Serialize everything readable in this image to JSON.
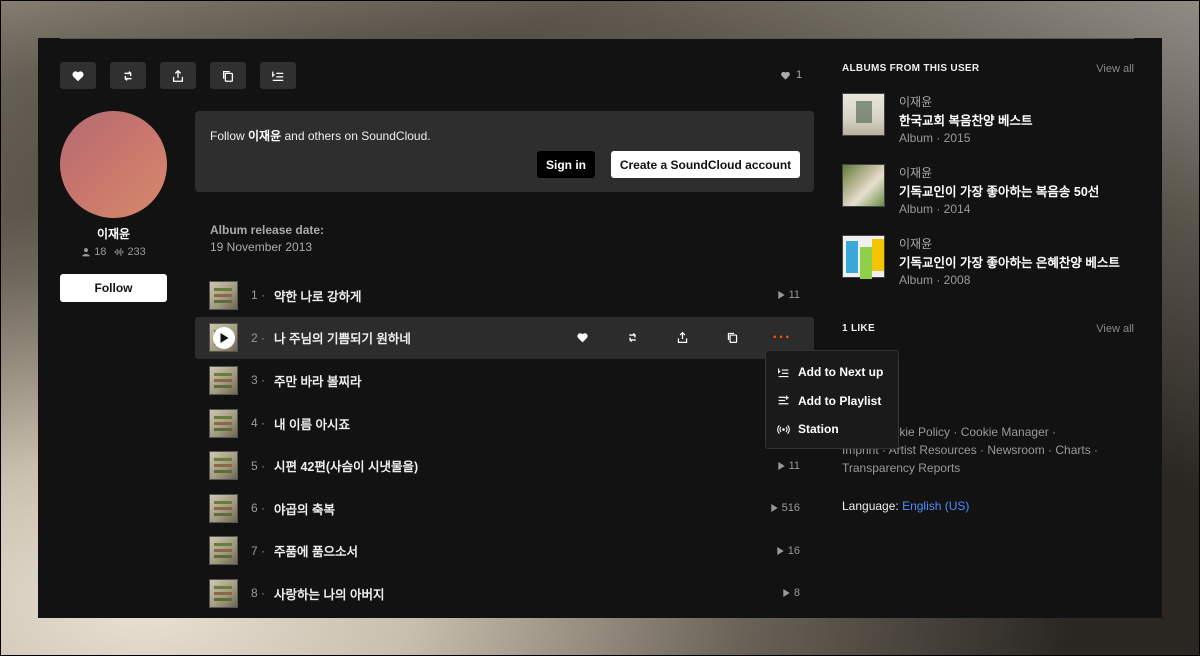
{
  "actions": {
    "like": "like",
    "repost": "repost",
    "share": "share",
    "copy": "copy link",
    "add_to_next_up": "add to next up"
  },
  "likes_count": "1",
  "user": {
    "name": "이재윤",
    "followers": "18",
    "tracks": "233",
    "follow_label": "Follow"
  },
  "follow_box": {
    "text_prefix": "Follow ",
    "text_name": "이재윤",
    "text_suffix": " and others on SoundCloud.",
    "signin_label": "Sign in",
    "create_label": "Create a SoundCloud account"
  },
  "release": {
    "label": "Album release date:",
    "date": "19 November 2013"
  },
  "tracks": [
    {
      "num": "1 ·",
      "title": "약한 나로 강하게",
      "plays": "11"
    },
    {
      "num": "2 ·",
      "title": "나 주님의 기쁨되기 원하네",
      "plays": ""
    },
    {
      "num": "3 ·",
      "title": "주만 바라 볼찌라",
      "plays": ""
    },
    {
      "num": "4 ·",
      "title": "내 이름 아시죠",
      "plays": ""
    },
    {
      "num": "5 ·",
      "title": "시편 42편(사슴이 시냇물을)",
      "plays": "11"
    },
    {
      "num": "6 ·",
      "title": "야곱의 축복",
      "plays": "516"
    },
    {
      "num": "7 ·",
      "title": "주품에 품으소서",
      "plays": "16"
    },
    {
      "num": "8 ·",
      "title": "사랑하는 나의 아버지",
      "plays": "8"
    }
  ],
  "more_dots": "···",
  "menu": {
    "items": [
      {
        "label": "Add to Next up",
        "icon": "next-up-icon"
      },
      {
        "label": "Add to Playlist",
        "icon": "playlist-icon"
      },
      {
        "label": "Station",
        "icon": "station-icon"
      }
    ]
  },
  "albums_section": {
    "title": "ALBUMS FROM THIS USER",
    "view_all": "View all",
    "albums": [
      {
        "artist": "이재윤",
        "title": "한국교회 복음찬양 베스트",
        "meta": "Album · 2015"
      },
      {
        "artist": "이재윤",
        "title": "기독교인이 가장 좋아하는 복음송 50선",
        "meta": "Album · 2014"
      },
      {
        "artist": "이재윤",
        "title": "기독교인이 가장 좋아하는 은혜찬양 베스트",
        "meta": "Album · 2008"
      }
    ]
  },
  "likes_section": {
    "title": "1 LIKE",
    "view_all": "View all"
  },
  "footer": {
    "line1": "vacy · Cookie Policy · Cookie Manager ·",
    "line2": "Imprint · Artist Resources · Newsroom · Charts ·",
    "line3": "Transparency Reports"
  },
  "language": {
    "label": "Language: ",
    "value": "English (US)"
  },
  "colors": {
    "accent": "#ff5500",
    "link": "#4a8dff",
    "panel_bg": "#121212"
  }
}
